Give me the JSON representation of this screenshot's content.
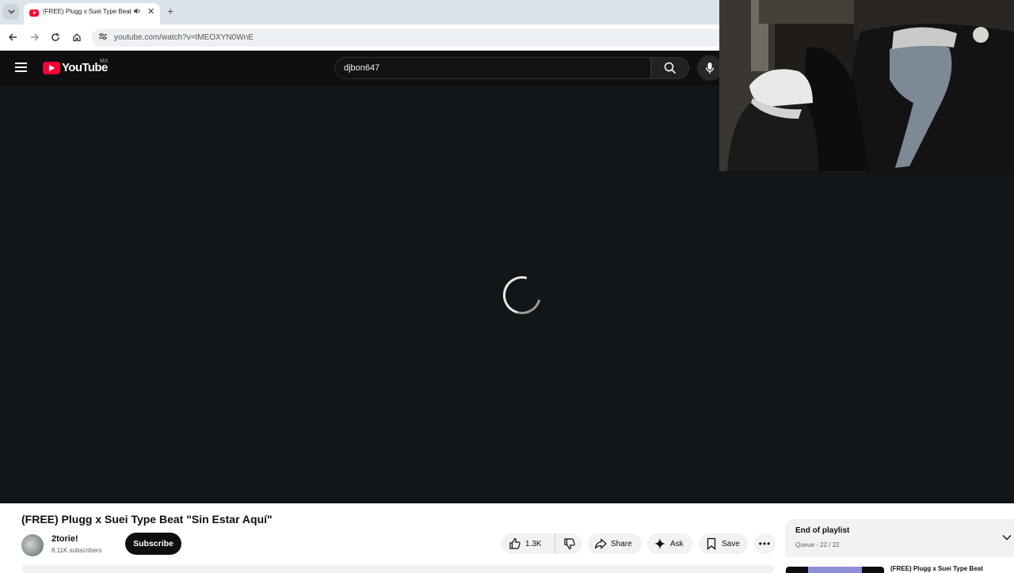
{
  "browser": {
    "tab_title": "(FREE) Plugg x Suei Type Beat",
    "url": "youtube.com/watch?v=tMEOXYN0WnE",
    "new_tab_symbol": "+",
    "close_symbol": "✕"
  },
  "masthead": {
    "logo_text": "YouTube",
    "region": "MX",
    "search_value": "djbon647"
  },
  "video": {
    "title": "(FREE) Plugg x Suei Type Beat \"Sin Estar Aquí\"",
    "channel_name": "2torie!",
    "subscribers": "8.11K subscribers",
    "subscribe_label": "Subscribe",
    "like_count": "1.3K",
    "share_label": "Share",
    "ask_label": "Ask",
    "save_label": "Save",
    "more_label": "•••"
  },
  "playlist": {
    "title": "End of playlist",
    "meta": "Queue - 22 / 22",
    "next_title": "(FREE) Plugg x Suei Type Beat"
  },
  "colors": {
    "masthead_bg": "#0f0f0f",
    "player_bg": "#121618",
    "brand_red": "#ff0033"
  },
  "icons": {
    "tab_favicon": "youtube-icon",
    "audio": "speaker-icon",
    "back": "arrow-left-icon",
    "forward": "arrow-right-icon",
    "reload": "reload-icon",
    "home": "home-icon",
    "site_info": "tune-icon",
    "menu": "hamburger-icon",
    "search": "search-icon",
    "mic": "mic-icon",
    "like": "thumbs-up-icon",
    "dislike": "thumbs-down-icon",
    "share": "share-icon",
    "ask": "sparkle-icon",
    "save": "bookmark-icon",
    "chevron": "chevron-down-icon",
    "loading": "spinner-icon"
  }
}
